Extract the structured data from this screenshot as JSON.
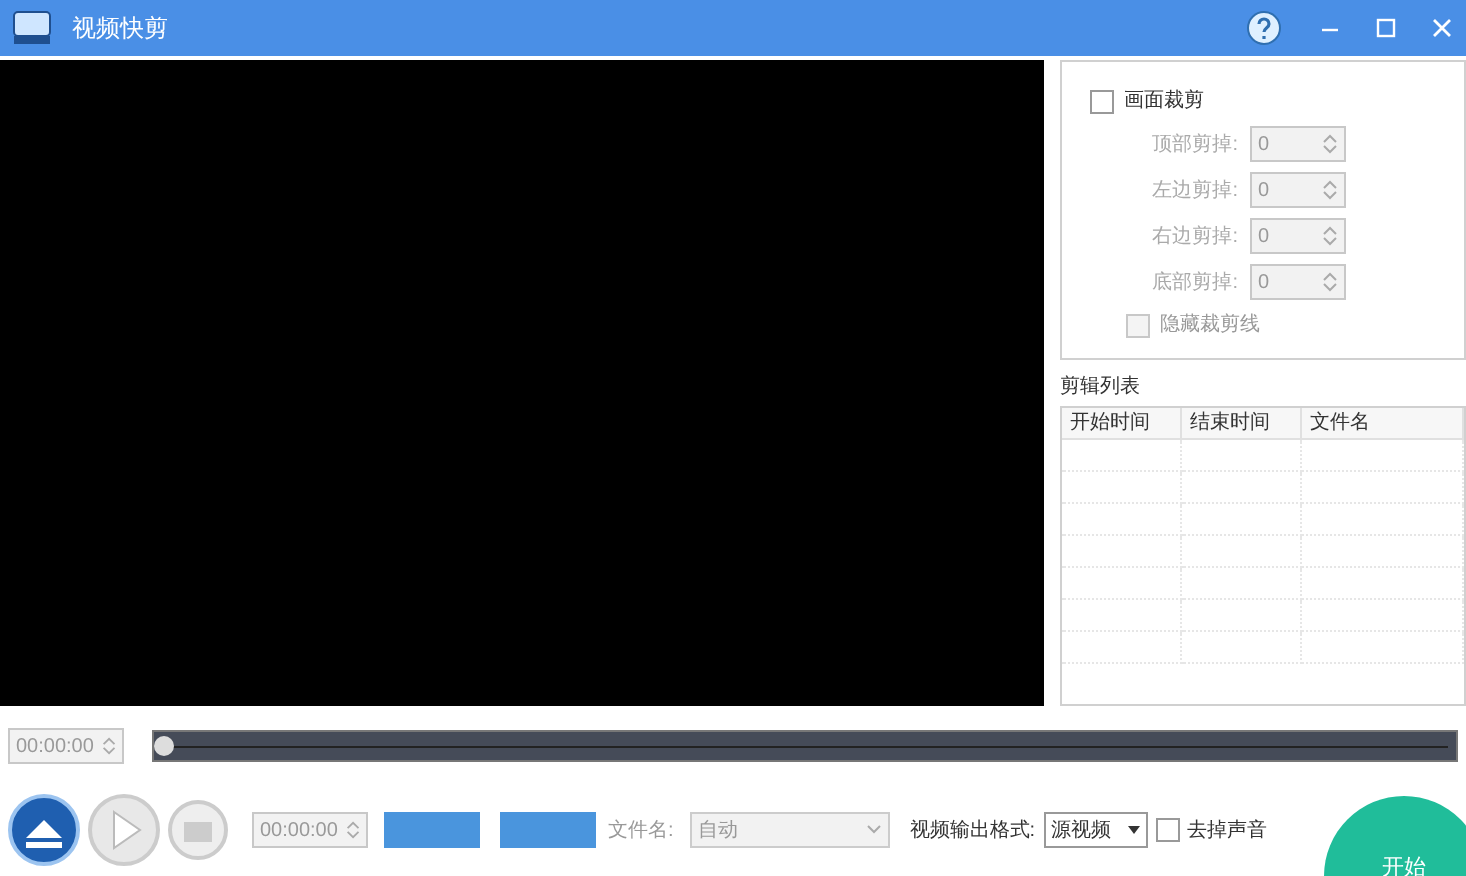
{
  "window": {
    "title": "视频快剪"
  },
  "crop": {
    "label": "画面裁剪",
    "checked": false,
    "fields": [
      {
        "label": "顶部剪掉:",
        "value": "0"
      },
      {
        "label": "左边剪掉:",
        "value": "0"
      },
      {
        "label": "右边剪掉:",
        "value": "0"
      },
      {
        "label": "底部剪掉:",
        "value": "0"
      }
    ],
    "hide_lines": {
      "label": "隐藏裁剪线",
      "checked": false
    }
  },
  "clip_list": {
    "title": "剪辑列表",
    "columns": [
      "开始时间",
      "结束时间",
      "文件名"
    ]
  },
  "timeline": {
    "time": "00:00:00",
    "level": 0
  },
  "controls": {
    "time": "00:00:00",
    "filename_label": "文件名:",
    "filename": "自动",
    "format_label": "视频输出格式:",
    "format": "源视频",
    "mute": {
      "label": "去掉声音",
      "checked": false
    },
    "start": "开始"
  }
}
